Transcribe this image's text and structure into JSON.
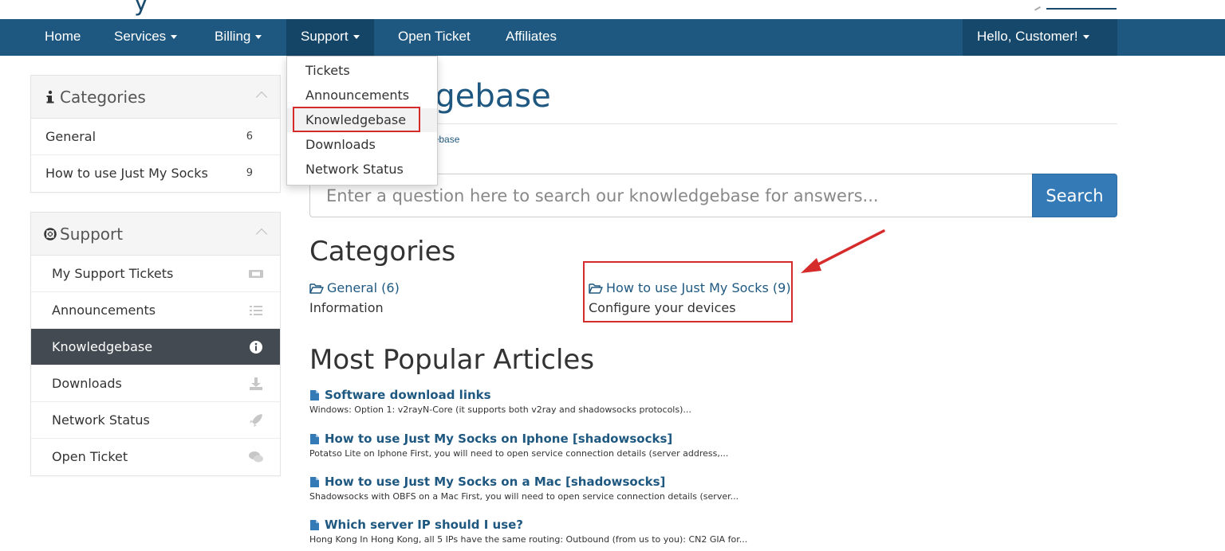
{
  "nav": {
    "items": [
      {
        "label": "Home"
      },
      {
        "label": "Services"
      },
      {
        "label": "Billing"
      },
      {
        "label": "Support"
      },
      {
        "label": "Open Ticket"
      },
      {
        "label": "Affiliates"
      }
    ],
    "user": "Hello, Customer!"
  },
  "dropdown": {
    "items": [
      "Tickets",
      "Announcements",
      "Knowledgebase",
      "Downloads",
      "Network Status"
    ]
  },
  "sidebar": {
    "categories": {
      "title": "Categories",
      "items": [
        {
          "label": "General",
          "count": "6"
        },
        {
          "label": "How to use Just My Socks",
          "count": "9"
        }
      ]
    },
    "support": {
      "title": "Support",
      "items": [
        {
          "label": "My Support Tickets",
          "icon": "ticket-icon"
        },
        {
          "label": "Announcements",
          "icon": "list-icon"
        },
        {
          "label": "Knowledgebase",
          "icon": "info-circle-icon"
        },
        {
          "label": "Downloads",
          "icon": "download-icon"
        },
        {
          "label": "Network Status",
          "icon": "rocket-icon"
        },
        {
          "label": "Open Ticket",
          "icon": "comments-icon"
        }
      ]
    }
  },
  "main": {
    "title_fragment": "dgebase",
    "breadcrumb_fragment": "gebase",
    "search": {
      "placeholder": "Enter a question here to search our knowledgebase for answers...",
      "button": "Search"
    },
    "categories_heading": "Categories",
    "categories": [
      {
        "link": "General (6)",
        "desc": "Information"
      },
      {
        "link": "How to use Just My Socks (9)",
        "desc": "Configure your devices"
      }
    ],
    "popular_heading": "Most Popular Articles",
    "articles": [
      {
        "title": "Software download links",
        "desc": "Windows: Option 1: v2rayN-Core (it supports both v2ray and shadowsocks protocols)..."
      },
      {
        "title": "How to use Just My Socks on Iphone [shadowsocks]",
        "desc": "Potatso Lite on Iphone First, you will need to open service connection details (server address,..."
      },
      {
        "title": "How to use Just My Socks on a Mac [shadowsocks]",
        "desc": "Shadowsocks with OBFS on a Mac First, you will need to open service connection details (server..."
      },
      {
        "title": "Which server IP should I use?",
        "desc": "Hong Kong In Hong Kong, all 5 IPs have the same routing: Outbound (from us to you): CN2 GIA for..."
      }
    ]
  },
  "colors": {
    "navbar": "#1e5880",
    "accent": "#337ab7",
    "highlight": "#d62b2b",
    "active_row": "#434a51"
  }
}
